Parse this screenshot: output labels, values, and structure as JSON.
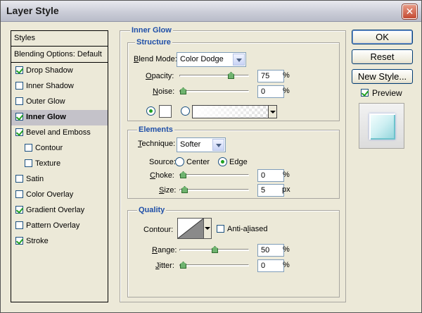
{
  "window": {
    "title": "Layer Style",
    "close_glyph": "✕"
  },
  "styles_list": {
    "header": "Styles",
    "blending": "Blending Options: Default",
    "items": [
      {
        "label": "Drop Shadow",
        "checked": true,
        "sub": false,
        "selected": false
      },
      {
        "label": "Inner Shadow",
        "checked": false,
        "sub": false,
        "selected": false
      },
      {
        "label": "Outer Glow",
        "checked": false,
        "sub": false,
        "selected": false
      },
      {
        "label": "Inner Glow",
        "checked": true,
        "sub": false,
        "selected": true
      },
      {
        "label": "Bevel and Emboss",
        "checked": true,
        "sub": false,
        "selected": false
      },
      {
        "label": "Contour",
        "checked": false,
        "sub": true,
        "selected": false
      },
      {
        "label": "Texture",
        "checked": false,
        "sub": true,
        "selected": false
      },
      {
        "label": "Satin",
        "checked": false,
        "sub": false,
        "selected": false
      },
      {
        "label": "Color Overlay",
        "checked": false,
        "sub": false,
        "selected": false
      },
      {
        "label": "Gradient Overlay",
        "checked": true,
        "sub": false,
        "selected": false
      },
      {
        "label": "Pattern Overlay",
        "checked": false,
        "sub": false,
        "selected": false
      },
      {
        "label": "Stroke",
        "checked": true,
        "sub": false,
        "selected": false
      }
    ]
  },
  "panel": {
    "title": "Inner Glow",
    "structure": {
      "legend": "Structure",
      "blend_mode": {
        "label_u": "B",
        "label_rest": "lend Mode:",
        "value": "Color Dodge"
      },
      "opacity": {
        "label_u": "O",
        "label_rest": "pacity:",
        "value": "75",
        "unit": "%",
        "level": 0.75
      },
      "noise": {
        "label_u": "N",
        "label_rest": "oise:",
        "value": "0",
        "unit": "%",
        "level": 0.0
      },
      "color_mode": "solid"
    },
    "elements": {
      "legend": "Elements",
      "technique": {
        "label_u": "T",
        "label_rest": "echnique:",
        "value": "Softer"
      },
      "source": {
        "label": "Source:",
        "center": "Center",
        "edge": "Edge",
        "selected": "edge"
      },
      "choke": {
        "label_u": "C",
        "label_rest": "hoke:",
        "value": "0",
        "unit": "%",
        "level": 0.0
      },
      "size": {
        "label_u": "S",
        "label_rest": "ize:",
        "value": "5",
        "unit": "px",
        "level": 0.02
      }
    },
    "quality": {
      "legend": "Quality",
      "contour": {
        "label": "Contour:"
      },
      "anti_aliased": {
        "label_u": "l",
        "label_pre": "Anti-a",
        "label_rest": "iased",
        "checked": false
      },
      "range": {
        "label_u": "R",
        "label_rest": "ange:",
        "value": "50",
        "unit": "%",
        "level": 0.5
      },
      "jitter": {
        "label_u": "J",
        "label_rest": "itter:",
        "value": "0",
        "unit": "%",
        "level": 0.0
      }
    }
  },
  "buttons": {
    "ok": "OK",
    "reset": "Reset",
    "new_style": "New Style...",
    "preview": {
      "label": "Preview",
      "checked": true
    }
  }
}
